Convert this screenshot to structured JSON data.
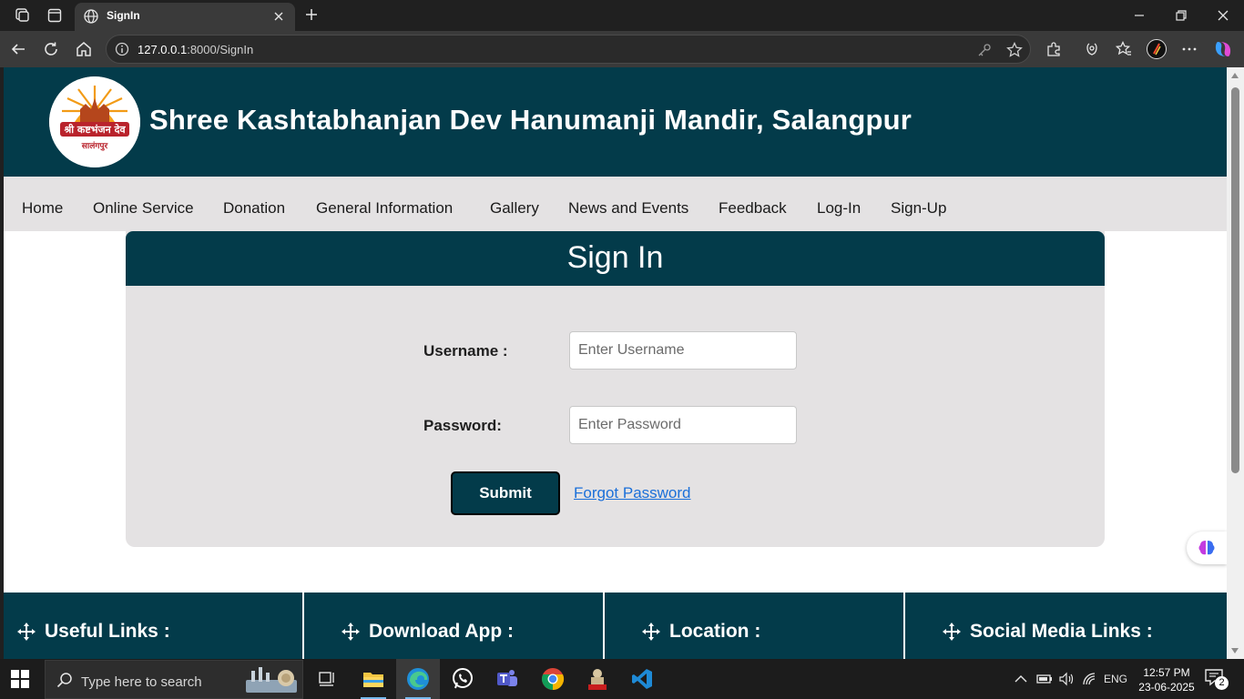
{
  "browser": {
    "tab_title": "SignIn",
    "url_host": "127.0.0.1",
    "url_rest": ":8000/SignIn"
  },
  "site": {
    "title": "Shree Kashtabhanjan Dev Hanumanji Mandir, Salangpur",
    "logo_text_top": "श्री कष्टभंजन देव",
    "logo_text_bottom": "सालंगपुर"
  },
  "menu": {
    "items": [
      "Home",
      "Online Service",
      "Donation",
      "General Information",
      "Gallery",
      "News and Events",
      "Feedback",
      "Log-In",
      "Sign-Up"
    ]
  },
  "signin": {
    "title": "Sign In",
    "username_label": "Username :",
    "username_placeholder": "Enter Username",
    "password_label": "Password:",
    "password_placeholder": "Enter Password",
    "submit_label": "Submit",
    "forgot_label": "Forgot Password"
  },
  "footer": {
    "columns": [
      "Useful Links :",
      "Download App :",
      "Location :",
      "Social Media Links :"
    ]
  },
  "taskbar": {
    "search_placeholder": "Type here to search",
    "language": "ENG",
    "time": "12:57 PM",
    "date": "23-06-2025",
    "notification_count": "2"
  },
  "colors": {
    "brand_dark": "#033b4a",
    "menu_bg": "#e4e2e3",
    "link": "#1a6fd9"
  }
}
